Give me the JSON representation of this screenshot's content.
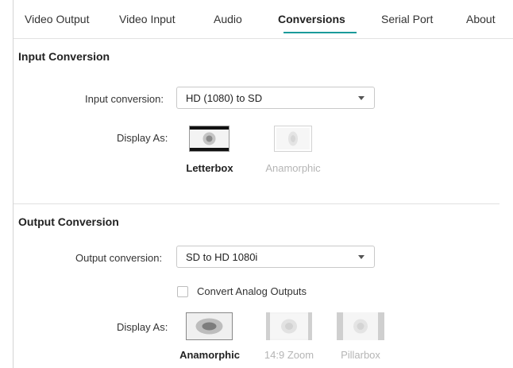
{
  "tabs": [
    {
      "label": "Video Output",
      "active": false
    },
    {
      "label": "Video Input",
      "active": false
    },
    {
      "label": "Audio",
      "active": false
    },
    {
      "label": "Conversions",
      "active": true
    },
    {
      "label": "Serial Port",
      "active": false
    },
    {
      "label": "About",
      "active": false
    }
  ],
  "accent_color": "#1a9a9a",
  "input_section": {
    "title": "Input Conversion",
    "conversion_label": "Input conversion:",
    "conversion_value": "HD (1080) to SD",
    "display_as_label": "Display As:",
    "options": [
      {
        "label": "Letterbox",
        "selected": true,
        "icon": "letterbox-icon"
      },
      {
        "label": "Anamorphic",
        "selected": false,
        "icon": "anamorphic-icon"
      }
    ]
  },
  "output_section": {
    "title": "Output Conversion",
    "conversion_label": "Output conversion:",
    "conversion_value": "SD to HD 1080i",
    "checkbox_label": "Convert Analog Outputs",
    "checkbox_checked": false,
    "display_as_label": "Display As:",
    "options": [
      {
        "label": "Anamorphic",
        "selected": true,
        "icon": "anamorphic-icon"
      },
      {
        "label": "14:9 Zoom",
        "selected": false,
        "icon": "zoom-14-9-icon"
      },
      {
        "label": "Pillarbox",
        "selected": false,
        "icon": "pillarbox-icon"
      }
    ]
  }
}
